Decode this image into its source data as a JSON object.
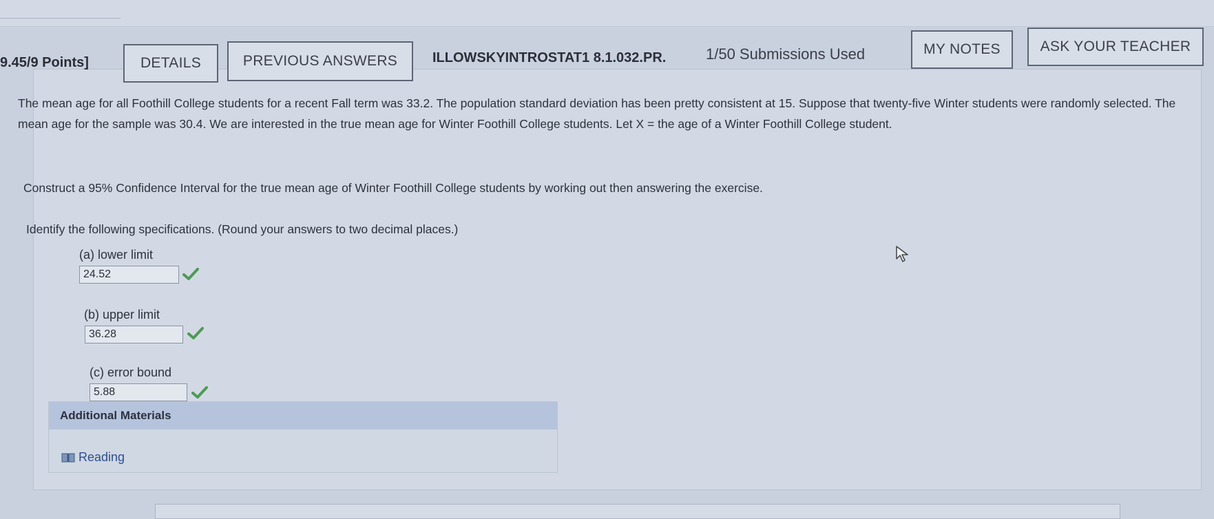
{
  "header": {
    "points": "9.45/9 Points]",
    "details_button": "DETAILS",
    "previous_answers_button": "PREVIOUS ANSWERS",
    "problem_id": "ILLOWSKYINTROSTAT1 8.1.032.PR.",
    "submissions": "1/50 Submissions Used",
    "my_notes_button": "MY NOTES",
    "ask_teacher_button": "ASK YOUR TEACHER"
  },
  "question": {
    "paragraph1": "The mean age for all Foothill College students for a recent Fall term was 33.2. The population standard deviation has been pretty consistent at 15. Suppose that twenty-five Winter students were randomly selected. The mean age for the sample was 30.4. We are interested in the true mean age for Winter Foothill College students. Let X = the age of a Winter Foothill College student.",
    "paragraph2": "Construct a 95% Confidence Interval for the true mean age of Winter Foothill College students by working out then answering the exercise.",
    "paragraph3": "Identify the following specifications. (Round your answers to two decimal places.)"
  },
  "answers": [
    {
      "label": "(a) lower limit",
      "value": "24.52",
      "status": "correct"
    },
    {
      "label": "(b) upper limit",
      "value": "36.28",
      "status": "correct"
    },
    {
      "label": "(c) error bound",
      "value": "5.88",
      "status": "correct"
    }
  ],
  "additional_materials": {
    "title": "Additional Materials",
    "link": "Reading",
    "link_icon": "book-icon"
  },
  "colors": {
    "check": "#4e9a55",
    "header_bg": "#b5c4dc",
    "link": "#2f4f8a"
  }
}
